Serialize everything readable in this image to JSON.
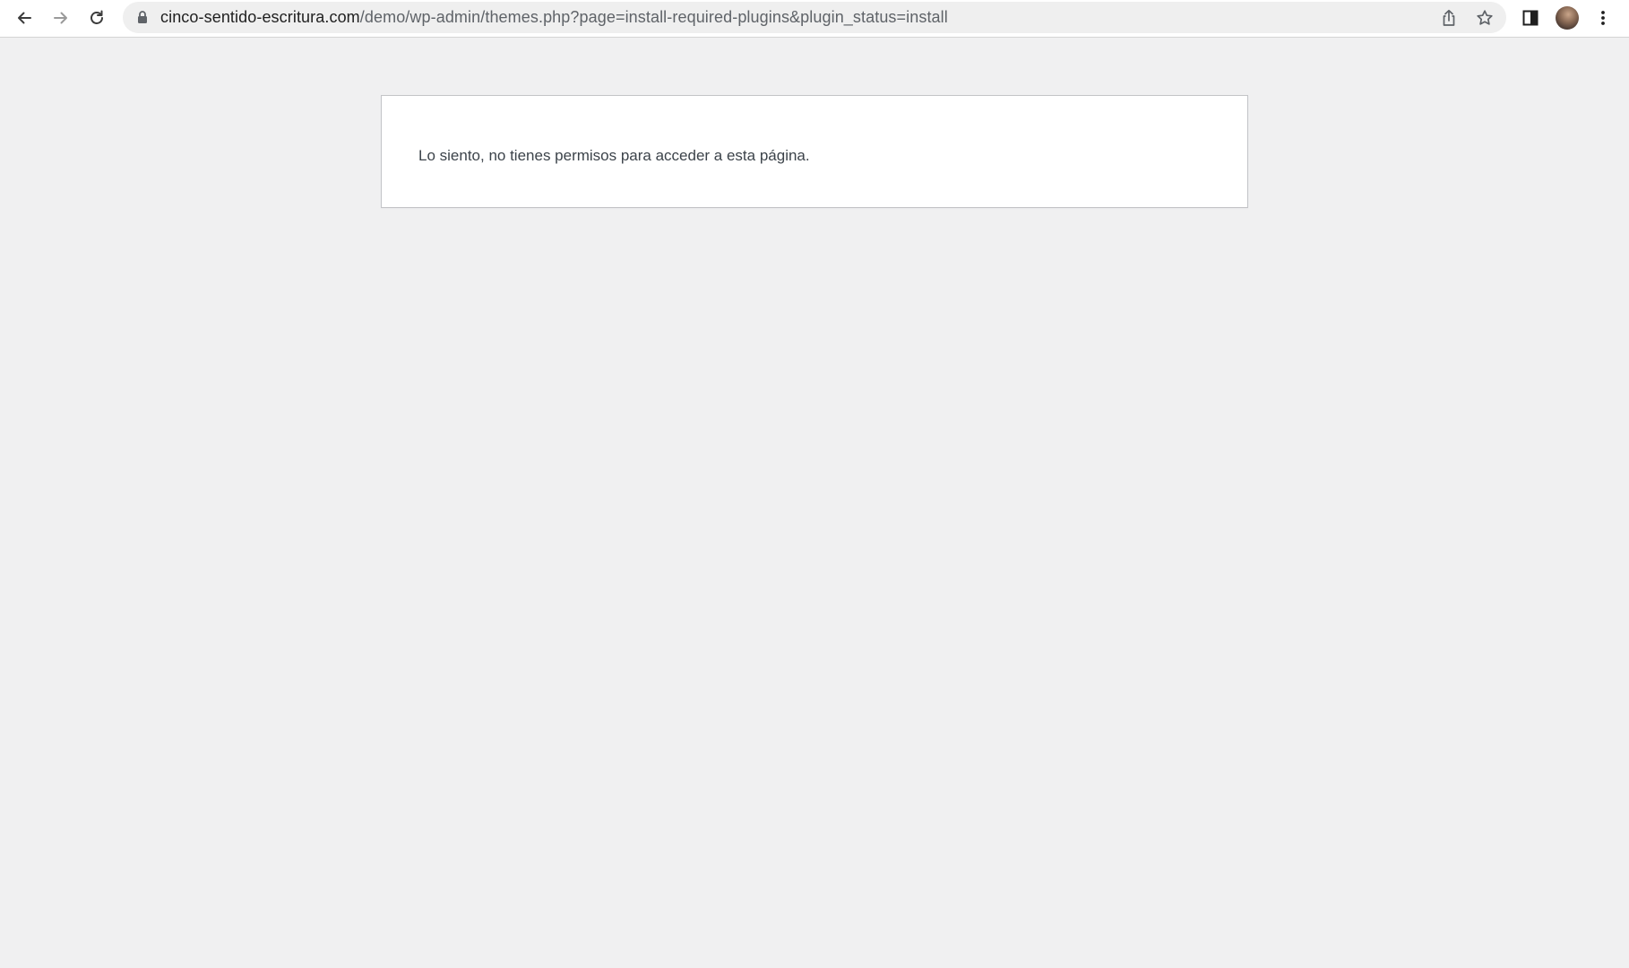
{
  "browser": {
    "url_host": "cinco-sentido-escritura.com",
    "url_path": "/demo/wp-admin/themes.php?page=install-required-plugins&plugin_status=install",
    "icons": {
      "back": "arrow-left-icon",
      "forward": "arrow-right-icon",
      "reload": "reload-icon",
      "lock": "lock-icon",
      "share": "share-icon",
      "bookmark": "star-icon",
      "side_panel": "side-panel-icon",
      "profile": "avatar",
      "menu": "kebab-menu-icon"
    }
  },
  "page": {
    "message": "Lo siento, no tienes permisos para acceder a esta página."
  },
  "colors": {
    "page_background": "#f0f0f1",
    "box_background": "#ffffff",
    "box_border": "#c3c4c7",
    "text": "#3c434a"
  }
}
